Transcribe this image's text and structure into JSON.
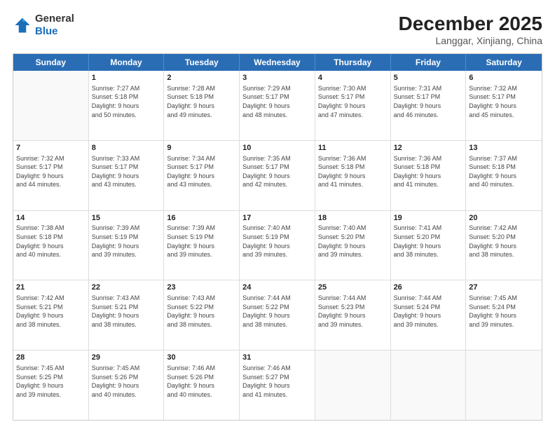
{
  "header": {
    "logo_general": "General",
    "logo_blue": "Blue",
    "title": "December 2025",
    "subtitle": "Langgar, Xinjiang, China"
  },
  "calendar": {
    "days": [
      "Sunday",
      "Monday",
      "Tuesday",
      "Wednesday",
      "Thursday",
      "Friday",
      "Saturday"
    ],
    "rows": [
      [
        {
          "num": "",
          "info": ""
        },
        {
          "num": "1",
          "info": "Sunrise: 7:27 AM\nSunset: 5:18 PM\nDaylight: 9 hours\nand 50 minutes."
        },
        {
          "num": "2",
          "info": "Sunrise: 7:28 AM\nSunset: 5:18 PM\nDaylight: 9 hours\nand 49 minutes."
        },
        {
          "num": "3",
          "info": "Sunrise: 7:29 AM\nSunset: 5:17 PM\nDaylight: 9 hours\nand 48 minutes."
        },
        {
          "num": "4",
          "info": "Sunrise: 7:30 AM\nSunset: 5:17 PM\nDaylight: 9 hours\nand 47 minutes."
        },
        {
          "num": "5",
          "info": "Sunrise: 7:31 AM\nSunset: 5:17 PM\nDaylight: 9 hours\nand 46 minutes."
        },
        {
          "num": "6",
          "info": "Sunrise: 7:32 AM\nSunset: 5:17 PM\nDaylight: 9 hours\nand 45 minutes."
        }
      ],
      [
        {
          "num": "7",
          "info": "Sunrise: 7:32 AM\nSunset: 5:17 PM\nDaylight: 9 hours\nand 44 minutes."
        },
        {
          "num": "8",
          "info": "Sunrise: 7:33 AM\nSunset: 5:17 PM\nDaylight: 9 hours\nand 43 minutes."
        },
        {
          "num": "9",
          "info": "Sunrise: 7:34 AM\nSunset: 5:17 PM\nDaylight: 9 hours\nand 43 minutes."
        },
        {
          "num": "10",
          "info": "Sunrise: 7:35 AM\nSunset: 5:17 PM\nDaylight: 9 hours\nand 42 minutes."
        },
        {
          "num": "11",
          "info": "Sunrise: 7:36 AM\nSunset: 5:18 PM\nDaylight: 9 hours\nand 41 minutes."
        },
        {
          "num": "12",
          "info": "Sunrise: 7:36 AM\nSunset: 5:18 PM\nDaylight: 9 hours\nand 41 minutes."
        },
        {
          "num": "13",
          "info": "Sunrise: 7:37 AM\nSunset: 5:18 PM\nDaylight: 9 hours\nand 40 minutes."
        }
      ],
      [
        {
          "num": "14",
          "info": "Sunrise: 7:38 AM\nSunset: 5:18 PM\nDaylight: 9 hours\nand 40 minutes."
        },
        {
          "num": "15",
          "info": "Sunrise: 7:39 AM\nSunset: 5:19 PM\nDaylight: 9 hours\nand 39 minutes."
        },
        {
          "num": "16",
          "info": "Sunrise: 7:39 AM\nSunset: 5:19 PM\nDaylight: 9 hours\nand 39 minutes."
        },
        {
          "num": "17",
          "info": "Sunrise: 7:40 AM\nSunset: 5:19 PM\nDaylight: 9 hours\nand 39 minutes."
        },
        {
          "num": "18",
          "info": "Sunrise: 7:40 AM\nSunset: 5:20 PM\nDaylight: 9 hours\nand 39 minutes."
        },
        {
          "num": "19",
          "info": "Sunrise: 7:41 AM\nSunset: 5:20 PM\nDaylight: 9 hours\nand 38 minutes."
        },
        {
          "num": "20",
          "info": "Sunrise: 7:42 AM\nSunset: 5:20 PM\nDaylight: 9 hours\nand 38 minutes."
        }
      ],
      [
        {
          "num": "21",
          "info": "Sunrise: 7:42 AM\nSunset: 5:21 PM\nDaylight: 9 hours\nand 38 minutes."
        },
        {
          "num": "22",
          "info": "Sunrise: 7:43 AM\nSunset: 5:21 PM\nDaylight: 9 hours\nand 38 minutes."
        },
        {
          "num": "23",
          "info": "Sunrise: 7:43 AM\nSunset: 5:22 PM\nDaylight: 9 hours\nand 38 minutes."
        },
        {
          "num": "24",
          "info": "Sunrise: 7:44 AM\nSunset: 5:22 PM\nDaylight: 9 hours\nand 38 minutes."
        },
        {
          "num": "25",
          "info": "Sunrise: 7:44 AM\nSunset: 5:23 PM\nDaylight: 9 hours\nand 39 minutes."
        },
        {
          "num": "26",
          "info": "Sunrise: 7:44 AM\nSunset: 5:24 PM\nDaylight: 9 hours\nand 39 minutes."
        },
        {
          "num": "27",
          "info": "Sunrise: 7:45 AM\nSunset: 5:24 PM\nDaylight: 9 hours\nand 39 minutes."
        }
      ],
      [
        {
          "num": "28",
          "info": "Sunrise: 7:45 AM\nSunset: 5:25 PM\nDaylight: 9 hours\nand 39 minutes."
        },
        {
          "num": "29",
          "info": "Sunrise: 7:45 AM\nSunset: 5:26 PM\nDaylight: 9 hours\nand 40 minutes."
        },
        {
          "num": "30",
          "info": "Sunrise: 7:46 AM\nSunset: 5:26 PM\nDaylight: 9 hours\nand 40 minutes."
        },
        {
          "num": "31",
          "info": "Sunrise: 7:46 AM\nSunset: 5:27 PM\nDaylight: 9 hours\nand 41 minutes."
        },
        {
          "num": "",
          "info": ""
        },
        {
          "num": "",
          "info": ""
        },
        {
          "num": "",
          "info": ""
        }
      ]
    ]
  }
}
